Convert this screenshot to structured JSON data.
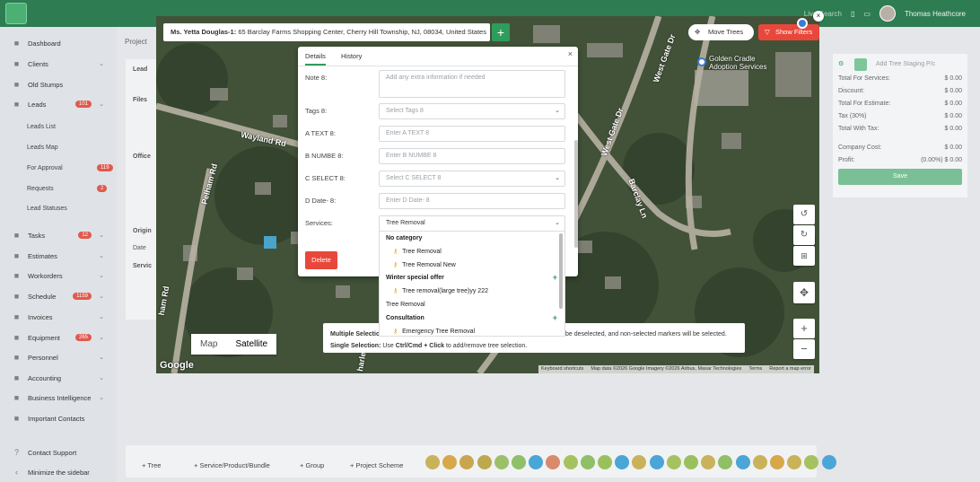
{
  "topbar": {
    "search_label": "Live Search",
    "user_name": "Thomas Heathcore"
  },
  "sidebar": {
    "items": [
      {
        "label": "Dashboard",
        "icon": "dashboard-icon"
      },
      {
        "label": "Clients",
        "icon": "clients-icon"
      },
      {
        "label": "Old Stumps",
        "icon": "stumps-icon"
      },
      {
        "label": "Leads",
        "icon": "leads-icon",
        "badge": "101"
      },
      {
        "label": "Tasks",
        "icon": "tasks-icon",
        "badge": "12"
      },
      {
        "label": "Estimates",
        "icon": "estimates-icon"
      },
      {
        "label": "Workorders",
        "icon": "workorders-icon"
      },
      {
        "label": "Schedule",
        "icon": "schedule-icon",
        "badge": "1159"
      },
      {
        "label": "Invoices",
        "icon": "invoices-icon"
      },
      {
        "label": "Equipment",
        "icon": "equipment-icon",
        "badge": "265"
      },
      {
        "label": "Personnel",
        "icon": "personnel-icon"
      },
      {
        "label": "Accounting",
        "icon": "accounting-icon"
      },
      {
        "label": "Business Intelligence",
        "icon": "bi-icon"
      },
      {
        "label": "Important Contacts",
        "icon": "contacts-icon"
      }
    ],
    "leads_sub": [
      {
        "label": "Leads List"
      },
      {
        "label": "Leads Map"
      },
      {
        "label": "For Approval",
        "badge": "119"
      },
      {
        "label": "Requests",
        "badge": "2"
      },
      {
        "label": "Lead Statuses"
      }
    ],
    "contact_support": "Contact Support",
    "minimize": "Minimize the sidebar"
  },
  "background": {
    "project_label": "Project",
    "lead_label": "Lead",
    "files_label": "Files",
    "office_label": "Office",
    "origin_label": "Origin",
    "date_label": "Date",
    "services_label": "Servic"
  },
  "summary": {
    "header": "Add Tree Staging P/c",
    "rows": [
      {
        "label": "Total For Services:",
        "value": "$ 0.00"
      },
      {
        "label": "Discount:",
        "value": "$ 0.00"
      },
      {
        "label": "Total For Estimate:",
        "value": "$ 0.00"
      },
      {
        "label": "Tax (30%)",
        "value": "$ 0.00"
      },
      {
        "label": "Total With Tax:",
        "value": "$ 0.00"
      },
      {
        "label": "Company Cost:",
        "value": "$ 0.00"
      },
      {
        "label": "Profit:",
        "value": "(0.00%) $ 0.00"
      }
    ],
    "save": "Save"
  },
  "bottom": {
    "tree": "Tree",
    "service": "Service/Product/Bundle",
    "group": "Group",
    "project": "Project Scheme"
  },
  "map": {
    "address_name": "Ms. Yetta Douglas-1:",
    "address": "65 Barclay Farms Shopping Center, Cherry Hill Township, NJ, 08034, United States",
    "move_trees": "Move Trees",
    "show_filters": "Show Filters",
    "poi_line1": "Golden Cradle",
    "poi_line2": "Adoption Services",
    "roads": [
      "Wayland Rd",
      "Pelham Rd",
      "West Gate Dr",
      "Barclay Ln",
      "ham Rd",
      "harle"
    ],
    "map_type": [
      "Map",
      "Satellite"
    ],
    "google": "Google",
    "attribution": [
      "Keyboard shortcuts",
      "Map data ©2026 Google Imagery ©2026 Airbus, Maxar Technologies",
      "Terms",
      "Report a map error"
    ],
    "help_multiple_label": "Multiple Selection",
    "help_multiple_text": "be deselected, and non-selected markers will be selected.",
    "help_single_label": "Single Selection:",
    "help_single_pre": "Use",
    "help_single_keys": "Ctrl/Cmd + Click",
    "help_single_post": "to add/remove tree selection."
  },
  "details_modal": {
    "tabs": [
      "Details",
      "History"
    ],
    "fields": [
      {
        "label": "Note 8:",
        "placeholder": "Add any extra information if needed"
      },
      {
        "label": "Tags 8:",
        "placeholder": "Select Tags 8"
      },
      {
        "label": "A TEXT 8:",
        "placeholder": "Enter A TEXT 8"
      },
      {
        "label": "B NUMBE 8:",
        "placeholder": "Enter B NUMBE 8"
      },
      {
        "label": "C SELECT 8:",
        "placeholder": "Select C SELECT 8"
      },
      {
        "label": "D Date- 8:",
        "placeholder": "Enter D Date- 8"
      },
      {
        "label": "Services:",
        "value": "Tree Removal"
      }
    ],
    "delete": "Delete"
  },
  "services_dropdown": [
    {
      "text": "No category",
      "type": "group"
    },
    {
      "text": "Tree Removal",
      "type": "option"
    },
    {
      "text": "Tree Removal New",
      "type": "option"
    },
    {
      "text": "Winter special offer",
      "type": "group-add"
    },
    {
      "text": "Tree removal(large tree)yy 222",
      "type": "option"
    },
    {
      "text": "Tree Removal",
      "type": "plain"
    },
    {
      "text": "Consultation",
      "type": "group-add"
    },
    {
      "text": "Emergency Tree Removal",
      "type": "option"
    }
  ]
}
